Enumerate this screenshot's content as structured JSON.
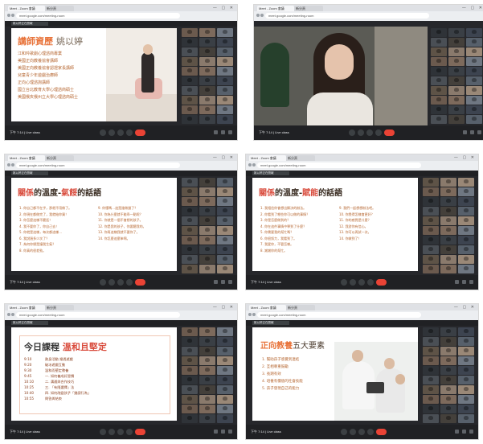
{
  "browser": {
    "tab_title": "Meet - Zoom 會議",
    "tab2_title": "新分頁",
    "url": "meet.google.com/meeting-room",
    "window_controls": "— ▢ ✕"
  },
  "meet": {
    "time": "下午 7:14 | Live class",
    "presenter_label": "姚以婷正在簡報"
  },
  "slide1": {
    "title": "講師資歷",
    "name": "姚以婷",
    "items": [
      "江和吟歌劇心理諮商專業",
      "美國正向教養協會講師",
      "美國正向教養協會認證家長講師",
      "兒童青少年遊戲治療師",
      "正向心理諮詢講師",
      "國立台北教育大學心理諮商碩士",
      "美國俄亥俄州立大學心理諮商碩士"
    ]
  },
  "slide3": {
    "title_a": "關係",
    "title_b": "的溫度-",
    "title_c": "氣餒",
    "title_d": "的話語",
    "left": [
      "1. 你自己都不在乎，那就不用做了。",
      "2. 你現在都做完了，我就給你買！",
      "3. 你怎麼這樣不聽話！",
      "4. 我不要你了，你自己去！",
      "5. 你就是這樣，每次都這樣…",
      "6. 我說過多少次了？",
      "7. 為何你總是讓我生氣？",
      "8. 你真的很差勁。"
    ],
    "right": [
      "9. 你懂嗎…這是誰做錯了？",
      "10. 你為什麼就不能乖一點呢？",
      "11. 你就是一個不會想的孩子。",
      "12. 你是我的孩子，你要聽我的。",
      "13. 你再這樣我就不要你了。",
      "14. 你怎麼這麼笨啊。"
    ]
  },
  "slide4": {
    "title_a": "關係",
    "title_b": "的溫度-",
    "title_c": "賦能",
    "title_d": "的話語",
    "left": [
      "1. 我相信你會想出解決的辦法。",
      "2. 你看到了哪些你可以做的事情？",
      "3. 你是怎麼做到的？",
      "4. 你在這件事情中學到了什麼？",
      "5. 你需要我的幫忙嗎？",
      "6. 你很努力，我看到了。",
      "7. 我愛你，不管怎樣。",
      "8. 謝謝你的幫忙。"
    ],
    "right": [
      "9. 我們一起想想辦法吧。",
      "10. 你覺得怎樣會更好？",
      "11. 你的感覺是什麼？",
      "12. 我對你有信心。",
      "13. 你可以再試一次。",
      "14. 你做到了！"
    ]
  },
  "slide5": {
    "title": "今日課程",
    "accent": "溫和且堅定",
    "rows": [
      {
        "t": "9:10",
        "d": "熱身活動 樂透遊戲"
      },
      {
        "t": "9:20",
        "d": "破冰遊戲互動"
      },
      {
        "t": "9:30",
        "d": "溫和而堅定教養"
      },
      {
        "t": "9:45",
        "d": "一. 如何養成好習慣"
      },
      {
        "t": "10:10",
        "d": "二. 溝通與合作技巧"
      },
      {
        "t": "10:25",
        "d": "三. 「有限選擇」法"
      },
      {
        "t": "10:40",
        "d": "四. 如何改變孩子「錯誤行為」"
      },
      {
        "t": "10:55",
        "d": "問答與結束"
      }
    ]
  },
  "slide6": {
    "title": "正向教養",
    "title2": "五大要素",
    "items": [
      "1. 幫助孩子感覺到連結",
      "2. 互相尊重鼓勵",
      "3. 長期有效",
      "4. 培養有價值的社會技能",
      "5. 孩子發現自己的能力"
    ]
  },
  "colors": {
    "accent": "#e8743b",
    "meet_bg": "#202124",
    "end_call": "#ea4335"
  }
}
